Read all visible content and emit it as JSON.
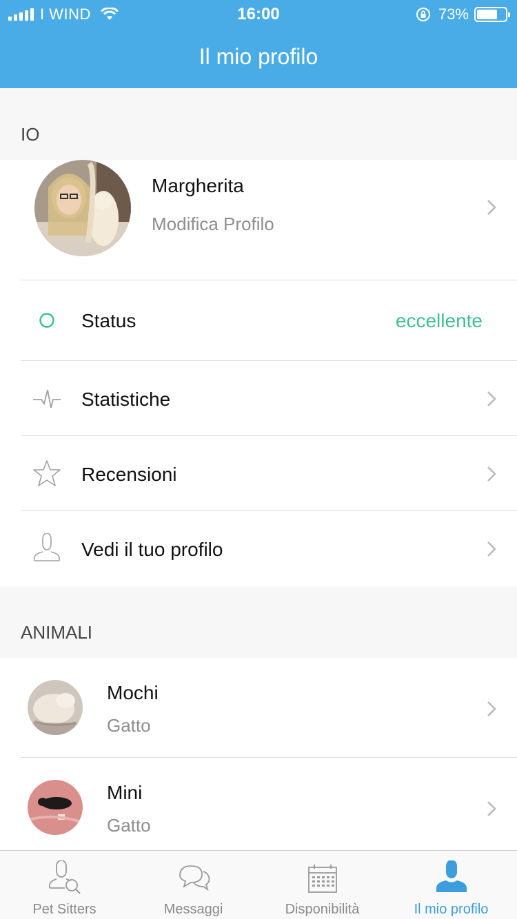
{
  "status_bar": {
    "carrier": "I WIND",
    "time": "16:00",
    "battery": "73%",
    "battery_level": 0.73
  },
  "nav": {
    "title": "Il mio profilo"
  },
  "sections": {
    "me": "IO",
    "animals": "ANIMALI"
  },
  "profile": {
    "name": "Margherita",
    "subtitle": "Modifica Profilo"
  },
  "menu": {
    "status": {
      "label": "Status",
      "value": "eccellente",
      "value_color": "#3fbf8f"
    },
    "stats": {
      "label": "Statistiche"
    },
    "reviews": {
      "label": "Recensioni"
    },
    "view_profile": {
      "label": "Vedi il tuo profilo"
    }
  },
  "pets": [
    {
      "name": "Mochi",
      "type": "Gatto"
    },
    {
      "name": "Mini",
      "type": "Gatto"
    }
  ],
  "tabs": [
    {
      "label": "Pet Sitters",
      "icon": "pet-sitters-icon"
    },
    {
      "label": "Messaggi",
      "icon": "messages-icon"
    },
    {
      "label": "Disponibilità",
      "icon": "calendar-icon"
    },
    {
      "label": "Il mio profilo",
      "icon": "profile-icon",
      "active": true
    }
  ],
  "colors": {
    "accent": "#4aace6",
    "tab_active": "#3c9edc",
    "status_good": "#3fbf8f"
  }
}
